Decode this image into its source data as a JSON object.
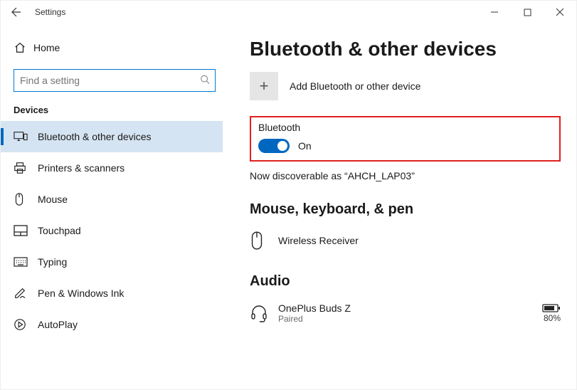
{
  "window": {
    "title": "Settings"
  },
  "sidebar": {
    "home_label": "Home",
    "search_placeholder": "Find a setting",
    "category_label": "Devices",
    "items": [
      {
        "label": "Bluetooth & other devices"
      },
      {
        "label": "Printers & scanners"
      },
      {
        "label": "Mouse"
      },
      {
        "label": "Touchpad"
      },
      {
        "label": "Typing"
      },
      {
        "label": "Pen & Windows Ink"
      },
      {
        "label": "AutoPlay"
      }
    ]
  },
  "main": {
    "heading": "Bluetooth & other devices",
    "add_label": "Add Bluetooth or other device",
    "bluetooth": {
      "label": "Bluetooth",
      "state": "On",
      "discoverable": "Now discoverable as “AHCH_LAP03”"
    },
    "section_mkp": {
      "heading": "Mouse, keyboard, & pen",
      "items": [
        {
          "name": "Wireless Receiver"
        }
      ]
    },
    "section_audio": {
      "heading": "Audio",
      "items": [
        {
          "name": "OnePlus Buds Z",
          "status": "Paired",
          "battery": "80%"
        }
      ]
    }
  }
}
